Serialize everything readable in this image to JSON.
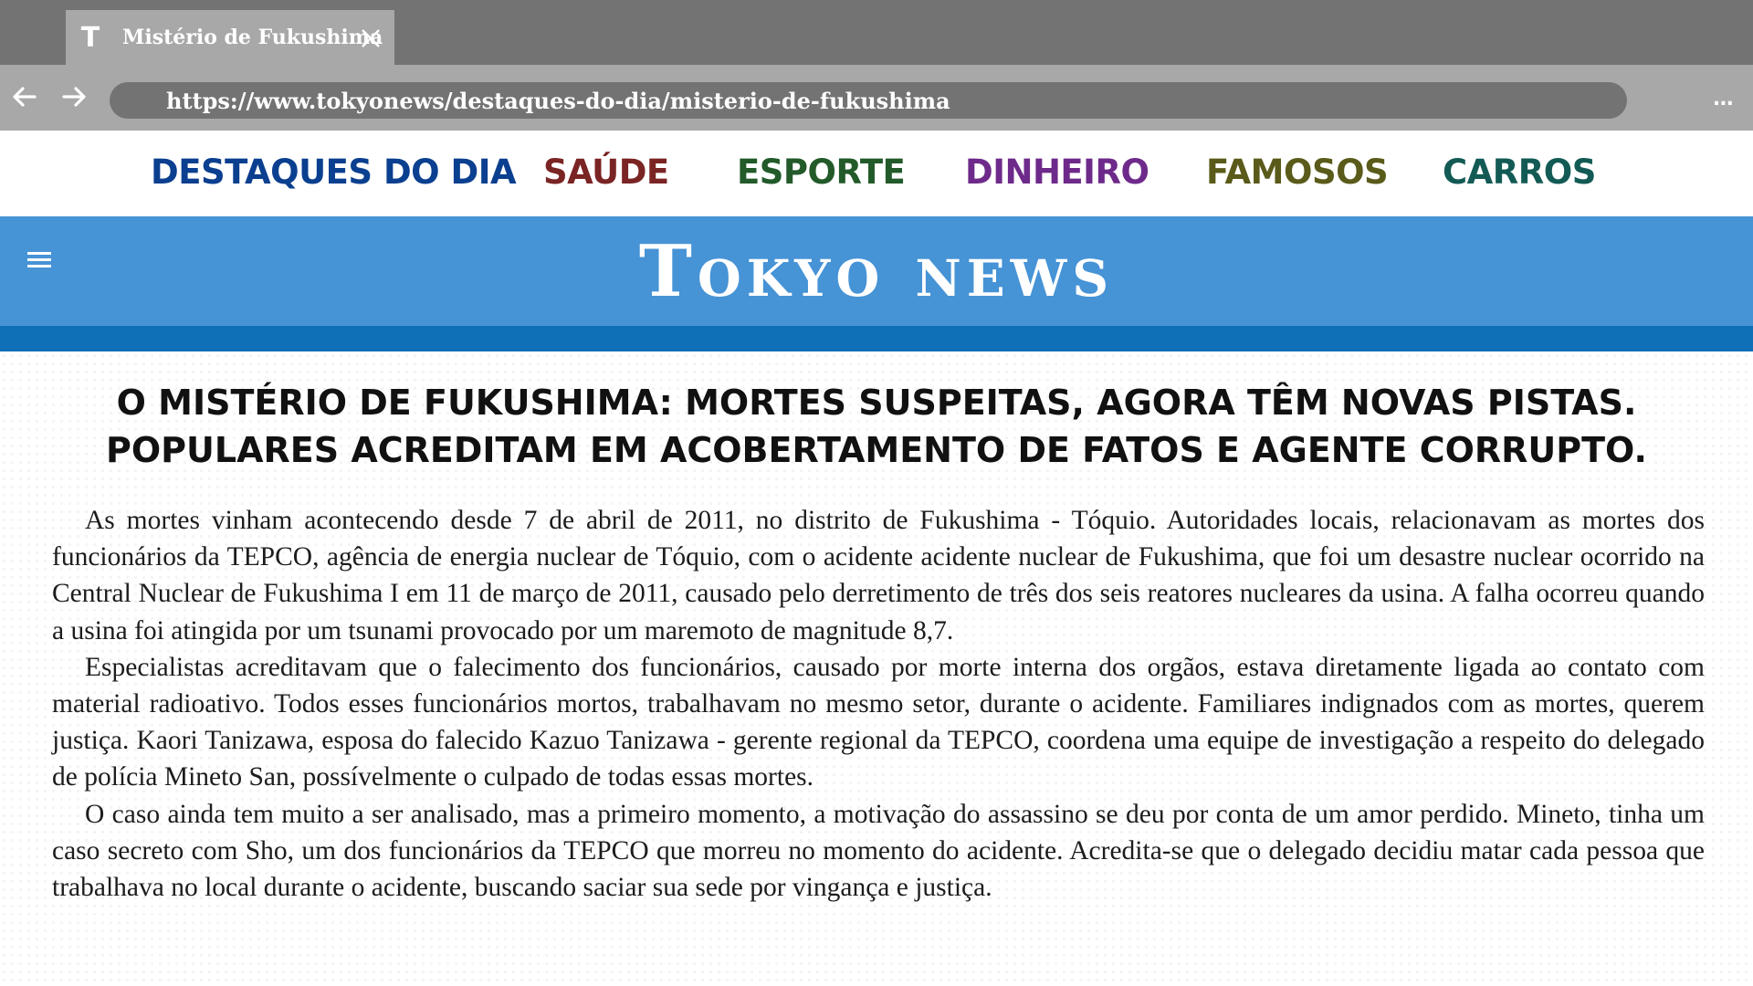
{
  "browser": {
    "tab": {
      "favicon": "T",
      "title": "Mistério de Fukushima",
      "close_icon": "close-icon"
    },
    "url": "https://www.tokyonews/destaques-do-dia/misterio-de-fukushima",
    "menu": "..."
  },
  "sections": [
    {
      "label": "DESTAQUES DO DIA",
      "color": "#0b3f8f"
    },
    {
      "label": "SAÚDE",
      "color": "#7a2424"
    },
    {
      "label": "ESPORTE",
      "color": "#225a2a"
    },
    {
      "label": "DINHEIRO",
      "color": "#6e2a8a"
    },
    {
      "label": "FAMOSOS",
      "color": "#5a5a1a"
    },
    {
      "label": "CARROS",
      "color": "#135a55"
    }
  ],
  "masthead": {
    "title": "Tokyo news",
    "colors": {
      "banner": "#4693d6",
      "band": "#0f6fb7"
    }
  },
  "article": {
    "headline": [
      "O MISTÉRIO DE FUKUSHIMA: MORTES SUSPEITAS, AGORA TÊM NOVAS PISTAS.",
      "POPULARES ACREDITAM EM ACOBERTAMENTO DE FATOS E AGENTE CORRUPTO."
    ],
    "paragraphs": [
      "As mortes vinham acontecendo desde 7 de abril de 2011, no distrito de Fukushima - Tóquio. Autoridades locais, relacionavam as mortes dos funcionários da TEPCO, agência de energia nuclear de Tóquio, com o acidente acidente nuclear de Fukushima, que foi um desastre nuclear ocorrido na Central Nuclear de Fukushima I em 11 de março de 2011, causado pelo derretimento de três dos seis reatores nucleares da usina. A falha ocorreu quando a usina foi atingida por um tsunami provocado por um maremoto de magnitude 8,7.",
      "Especialistas acreditavam que o falecimento dos funcionários, causado por morte interna dos orgãos, estava diretamente ligada ao contato com material radioativo. Todos esses funcionários mortos, trabalhavam no mesmo setor, durante o acidente. Familiares indignados com as mortes, querem justiça. Kaori Tanizawa, esposa do falecido Kazuo Tanizawa - gerente regional da TEPCO, coordena uma equipe de investigação a respeito do delegado de polícia Mineto San, possívelmente o culpado de todas essas mortes.",
      "O caso ainda tem muito a ser analisado, mas a primeiro momento, a motivação do assassino se deu por conta de um amor perdido. Mineto, tinha um caso secreto com Sho, um dos funcionários da TEPCO que morreu no momento do acidente. Acredita-se que o delegado decidiu matar cada pessoa que trabalhava no local durante o acidente, buscando saciar sua sede por vingança e justiça."
    ]
  }
}
